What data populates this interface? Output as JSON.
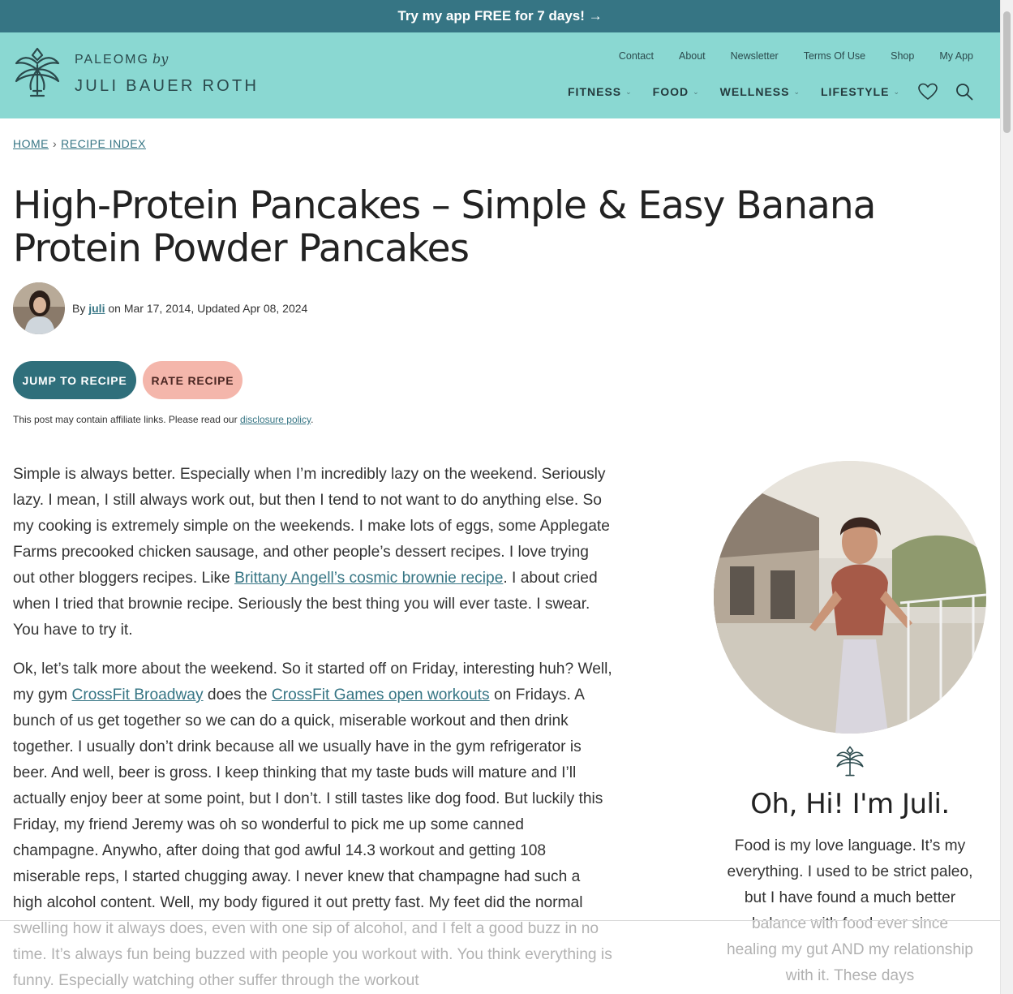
{
  "promo": {
    "text": "Try my app FREE for 7 days! →"
  },
  "logo": {
    "line1": "PALEOMG",
    "by": "by",
    "line2": "JULI BAUER ROTH"
  },
  "util_nav": [
    "Contact",
    "About",
    "Newsletter",
    "Terms Of Use",
    "Shop",
    "My App"
  ],
  "main_nav": [
    "FITNESS",
    "FOOD",
    "WELLNESS",
    "LIFESTYLE"
  ],
  "icons": {
    "favorites": "heart-icon",
    "search": "search-icon",
    "logo": "palm-logo-icon"
  },
  "breadcrumb": {
    "home": "HOME",
    "separator": "›",
    "index": "RECIPE INDEX"
  },
  "post": {
    "title": "High-Protein Pancakes – Simple & Easy Banana Protein Powder Pancakes",
    "by": "By",
    "author": "juli",
    "date_text": "on Mar 17, 2014, Updated Apr 08, 2024"
  },
  "buttons": {
    "jump": "JUMP TO RECIPE",
    "rate": "RATE RECIPE"
  },
  "disclosure": {
    "text": "This post may contain affiliate links. Please read our",
    "link": "disclosure policy",
    "end": "."
  },
  "article": {
    "p1_a": "Simple is always better. Especially when I’m incredibly lazy on the weekend. Seriously lazy. I mean, I still always work out, but then I tend to not want to do anything else. So my cooking is extremely simple on the weekends. I make lots of eggs, some Applegate Farms precooked chicken sausage, and other people’s dessert recipes. I love trying out other bloggers recipes. Like",
    "p1_link": "Brittany Angell’s cosmic brownie recipe",
    "p1_b": ". I about cried when I tried that brownie recipe. Seriously the best thing you will ever taste. I swear. You have to try it.",
    "p2_a": "Ok, let’s talk more about the weekend. So it started off on Friday, interesting huh? Well, my gym",
    "p2_link1": "CrossFit Broadway",
    "p2_b": "does the",
    "p2_link2": "CrossFit Games open workouts",
    "p2_c": "on Fridays. A bunch of us get together so we can do a quick, miserable workout and then drink together. I usually don’t drink because all we usually have in the gym refrigerator is beer. And well, beer is gross. I keep thinking that my taste buds will mature and I’ll actually enjoy beer at some point, but I don’t. I still tastes like dog food. But luckily this Friday, my friend Jeremy was oh so wonderful to pick me up some canned champagne. Anywho, after doing that god awful 14.3 workout and getting 108 miserable reps, I started chugging away. I never knew that champagne had such a high alcohol content. Well, my body figured it out pretty fast. My feet did the normal swelling how it always does, even with one sip of alcohol, and I felt a good buzz in no time. It’s always fun being buzzed with people you workout with. You think everything is funny. Especially watching other suffer through the workout"
  },
  "sidebar": {
    "heading": "Oh, Hi! I'm Juli.",
    "text": "Food is my love language. It’s my everything. I used to be strict paleo, but I have found a much better balance with food ever since healing my gut AND my relationship with it. These days"
  },
  "colors": {
    "promo_bg": "#367584",
    "header_bg": "#8ad8d2",
    "link": "#367584",
    "jump_btn": "#2f6f7b",
    "rate_btn": "#f4b6ab"
  }
}
